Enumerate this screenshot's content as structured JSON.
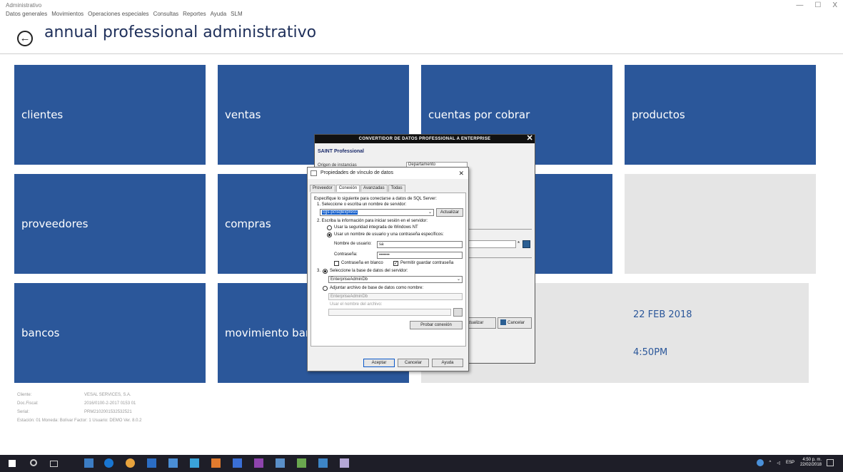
{
  "window": {
    "title": "Administrativo",
    "controls": [
      "—",
      "☐",
      "X"
    ]
  },
  "menu": [
    "Datos generales",
    "Movimientos",
    "Operaciones especiales",
    "Consultas",
    "Reportes",
    "Ayuda",
    "SLM"
  ],
  "header": {
    "title": "annual professional administrativo"
  },
  "tiles": {
    "clientes": "clientes",
    "ventas": "ventas",
    "cuentas": "cuentas por cobrar",
    "productos": "productos",
    "proveedores": "proveedores",
    "compras": "compras",
    "bancos": "bancos",
    "movimiento": "movimiento banc"
  },
  "datetime": {
    "date": "22 FEB 2018",
    "time": "4:50PM"
  },
  "footer": {
    "cliente_label": "Cliente:",
    "cliente_value": "VESAL SERVICES, S.A.",
    "doc_label": "Doc.Fiscal:",
    "doc_value": "2016/0100-2-2017 0153 01",
    "serial_label": "Serial:",
    "serial_value": "PRM2102001532532521",
    "status": "Estación: 01 Moneda: Bolívar Factor: 1 Usuario: DEMO Ver. 8.0.2"
  },
  "outer_dialog": {
    "title": "CONVERTIDOR DE DATOS PROFESSIONAL A ENTERPRISE",
    "section": "SAINT Professional",
    "origin_label": "Origen de instancias",
    "origin_value": "Departamento",
    "update_btn": "ctualizar",
    "cancel_btn": "Cancelar"
  },
  "dialog": {
    "title": "Propiedades de vínculo de datos",
    "tabs": [
      "Proveedor",
      "Conexión",
      "Avanzadas",
      "Todas"
    ],
    "intro": "Especifique lo siguiente para conectarse a datos de SQL Server:",
    "step1": "1. Seleccione o escriba un nombre de servidor:",
    "server_value": "cgs-pc\\sqlexpress",
    "refresh_btn": "Actualizar",
    "step2": "2. Escriba la información para iniciar sesión en el servidor:",
    "radio_nt": "Usar la seguridad integrada de Windows NT",
    "radio_user": "Usar un nombre de usuario y una contraseña específicos:",
    "user_label": "Nombre de usuario:",
    "user_value": "sa",
    "password_label": "Contraseña:",
    "password_value": "•••••••",
    "blank_password": "Contraseña en blanco",
    "save_password": "Permitir guardar contraseña",
    "step3": "Seleccione la base de datos del servidor:",
    "step3_num": "3.",
    "db_value": "EnterpriseAdminDb",
    "attach_label": "Adjuntar archivo de base de datos como nombre:",
    "attach_value": "EnterpriseAdminDb",
    "filename_placeholder": "Usar el nombre del archivo:",
    "test_btn": "Probar conexión",
    "ok_btn": "Aceptar",
    "cancel_btn": "Cancelar",
    "help_btn": "Ayuda"
  },
  "taskbar": {
    "lang": "ESP",
    "time": "4:50 p. m.",
    "date": "22/02/2018"
  }
}
